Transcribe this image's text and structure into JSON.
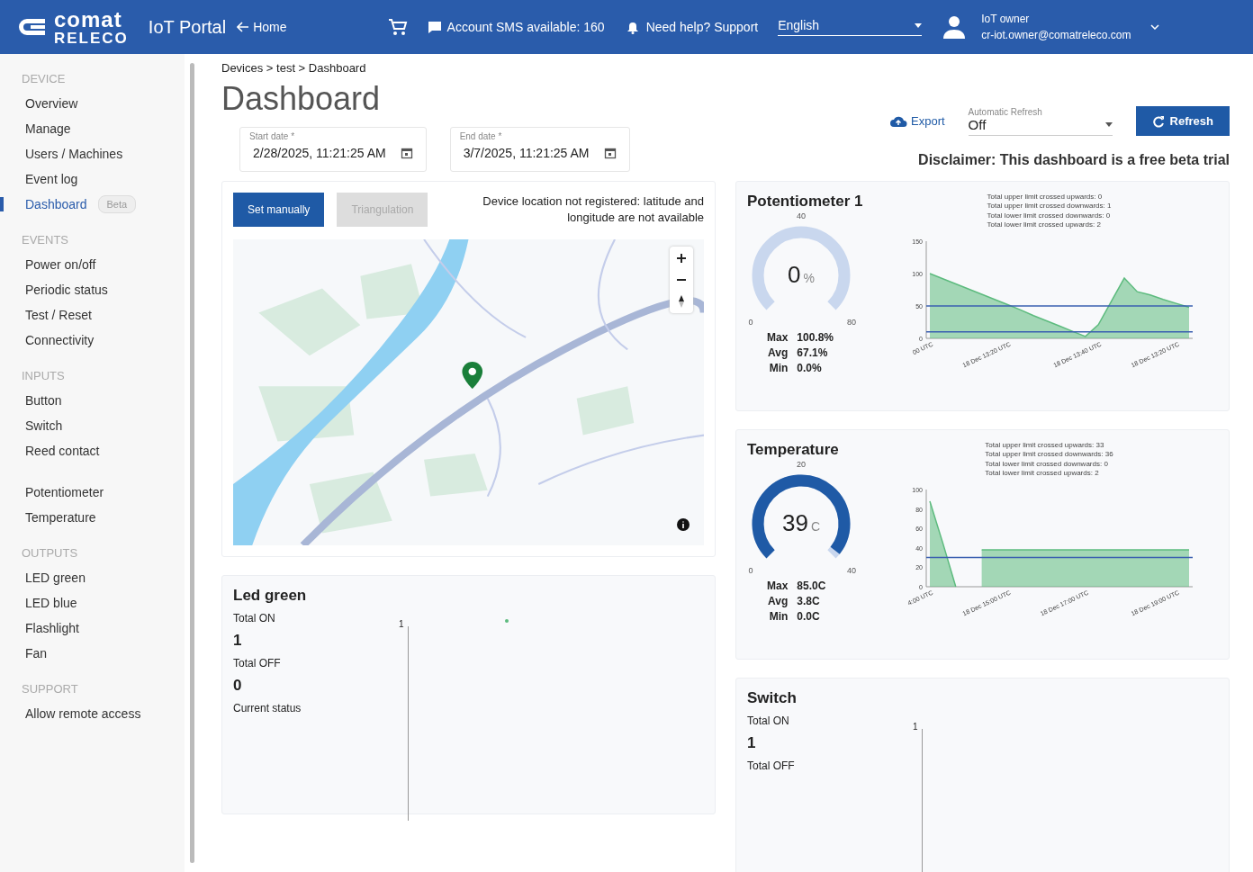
{
  "header": {
    "logo_top": "comat",
    "logo_bottom": "RELECO",
    "title": "IoT Portal",
    "home_link": "Home",
    "sms": "Account SMS available: 160",
    "help": "Need help? Support",
    "language": "English",
    "user_name": "IoT owner",
    "user_email": "cr-iot.owner@comatreleco.com"
  },
  "sidebar": {
    "sections": [
      {
        "title": "DEVICE",
        "items": [
          {
            "label": "Overview",
            "selected": false
          },
          {
            "label": "Manage",
            "selected": false
          },
          {
            "label": "Users / Machines",
            "selected": false
          },
          {
            "label": "Event log",
            "selected": false
          },
          {
            "label": "Dashboard",
            "selected": true,
            "badge": "Beta"
          }
        ]
      },
      {
        "title": "EVENTS",
        "items": [
          {
            "label": "Power on/off",
            "selected": false
          },
          {
            "label": "Periodic status",
            "selected": false
          },
          {
            "label": "Test / Reset",
            "selected": false
          },
          {
            "label": "Connectivity",
            "selected": false
          }
        ]
      },
      {
        "title": "INPUTS",
        "items": [
          {
            "label": "Button",
            "selected": false
          },
          {
            "label": "Switch",
            "selected": false
          },
          {
            "label": "Reed contact",
            "selected": false
          }
        ]
      },
      {
        "items": [
          {
            "label": "Potentiometer",
            "selected": false
          },
          {
            "label": "Temperature",
            "selected": false
          }
        ]
      },
      {
        "title": "OUTPUTS",
        "items": [
          {
            "label": "LED green",
            "selected": false
          },
          {
            "label": "LED blue",
            "selected": false
          },
          {
            "label": "Flashlight",
            "selected": false
          },
          {
            "label": "Fan",
            "selected": false
          }
        ]
      },
      {
        "title": "SUPPORT",
        "items": [
          {
            "label": "Allow remote access",
            "selected": false
          }
        ]
      }
    ]
  },
  "breadcrumb": "Devices > test > Dashboard",
  "page_title": "Dashboard",
  "start_date": {
    "label": "Start date *",
    "value": "2/28/2025, 11:21:25 AM"
  },
  "end_date": {
    "label": "End date *",
    "value": "3/7/2025, 11:21:25 AM"
  },
  "export": "Export",
  "auto_refresh": {
    "label": "Automatic Refresh",
    "value": "Off"
  },
  "refresh": "Refresh",
  "disclaimer": "Disclaimer: This dashboard is a free beta trial",
  "location": {
    "buttons": [
      {
        "label": "Set manually",
        "disabled": false
      },
      {
        "label": "Triangulation",
        "disabled": true
      }
    ],
    "message": "Device location not registered: latitude and longitude are not available"
  },
  "led_card": {
    "title": "Led green",
    "total_on_label": "Total ON",
    "total_on": "1",
    "total_off_label": "Total OFF",
    "total_off": "0",
    "status_label": "Current status",
    "axis_tick": "1"
  },
  "sensors": [
    {
      "title": "Potentiometer 1",
      "value": "0",
      "unit": "%",
      "gauge_ticks": [
        "0",
        "40",
        "80"
      ],
      "summary": [
        {
          "label": "Max",
          "value": "100.8%"
        },
        {
          "label": "Avg",
          "value": "67.1%"
        },
        {
          "label": "Min",
          "value": "0.0%"
        }
      ],
      "stats": [
        "Total upper limit crossed upwards: 0",
        "Total upper limit crossed downwards: 1",
        "Total lower limit crossed downwards: 0",
        "Total lower limit crossed upwards: 2"
      ],
      "chart_data": {
        "type": "area",
        "categories": [
          "00 UTC",
          null,
          null,
          null,
          null,
          null,
          "18 Dec 13:20 UTC",
          null,
          null,
          null,
          null,
          null,
          null,
          "18 Dec 13:40 UTC",
          null,
          null,
          null,
          null,
          null,
          "18 Dec 13:20 UTC",
          null
        ],
        "series": [
          {
            "color": "#5dbb7e",
            "values": [
              100,
              92,
              84,
              76,
              68,
              60,
              52,
              44,
              35,
              27,
              19,
              11,
              3,
              21,
              57,
              93,
              72,
              67,
              60,
              54,
              48
            ]
          }
        ],
        "ylim": [
          0,
          150
        ],
        "yticks": [
          0,
          50,
          100,
          150
        ],
        "ref_lines": [
          {
            "value": 50,
            "axis": "y"
          },
          {
            "value": 10,
            "axis": "y"
          }
        ]
      }
    },
    {
      "title": "Temperature",
      "value": "39",
      "unit": "C",
      "gauge_ticks": [
        "0",
        "20",
        "40"
      ],
      "summary": [
        {
          "label": "Max",
          "value": "85.0C"
        },
        {
          "label": "Avg",
          "value": "3.8C"
        },
        {
          "label": "Min",
          "value": "0.0C"
        }
      ],
      "stats": [
        "Total upper limit crossed upwards: 33",
        "Total upper limit crossed downwards: 36",
        "Total lower limit crossed downwards: 0",
        "Total lower limit crossed upwards: 2"
      ],
      "chart_data": {
        "type": "area",
        "categories": [
          "4:00 UTC",
          null,
          null,
          null,
          null,
          null,
          "18 Dec 15:00 UTC",
          null,
          null,
          null,
          null,
          null,
          "18 Dec 17:00 UTC",
          null,
          null,
          null,
          null,
          null,
          null,
          "18 Dec 19:00 UTC",
          null
        ],
        "series": [
          {
            "color": "#5dbb7e",
            "values": [
              88,
              45,
              0,
              null,
              38,
              38,
              38,
              38,
              38,
              38,
              38,
              38,
              38,
              38,
              38,
              38,
              38,
              38,
              38,
              38,
              38
            ]
          }
        ],
        "ylim": [
          0,
          100
        ],
        "yticks": [
          0,
          20,
          40,
          60,
          80,
          100
        ],
        "ref_lines": [
          {
            "value": 30,
            "axis": "y"
          }
        ]
      }
    }
  ],
  "switch_card": {
    "title": "Switch",
    "total_on_label": "Total ON",
    "total_on": "1",
    "total_off_label": "Total OFF",
    "axis_tick": "1"
  }
}
